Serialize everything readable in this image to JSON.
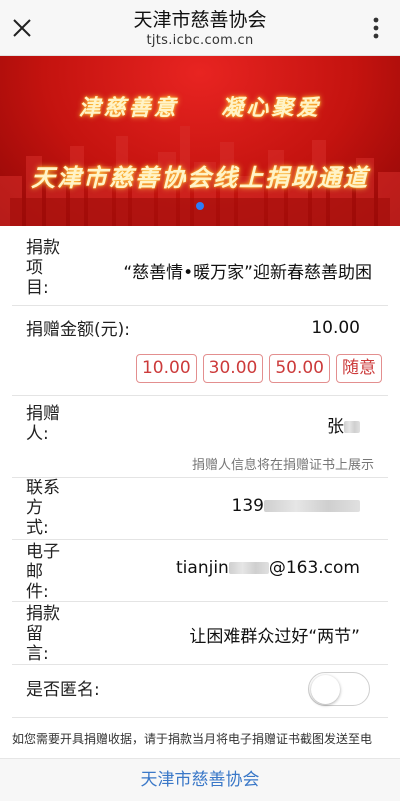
{
  "header": {
    "title": "天津市慈善协会",
    "url": "tjts.icbc.com.cn"
  },
  "banner": {
    "slogan_line1": "津慈善意    凝心聚爱",
    "slogan_line2": "天津市慈善协会线上捐助通道",
    "slide_count": 1,
    "active_slide": 0
  },
  "form": {
    "project": {
      "label_lines": [
        "捐款",
        "项",
        "目:"
      ],
      "value": "“慈善情•暖万家”迎新春慈善助困"
    },
    "amount": {
      "label": "捐赠金额(元):",
      "value": "10.00",
      "options": [
        "10.00",
        "30.00",
        "50.00",
        "随意"
      ]
    },
    "donor": {
      "label_lines": [
        "捐赠",
        "人:"
      ],
      "value_prefix": "张",
      "hint": "捐赠人信息将在捐赠证书上展示"
    },
    "contact": {
      "label_lines": [
        "联系",
        "方",
        "式:"
      ],
      "value_prefix": "139"
    },
    "email": {
      "label_lines": [
        "电子",
        "邮",
        "件:"
      ],
      "value_prefix": "tianjin",
      "value_suffix": "@163.com"
    },
    "message": {
      "label_lines": [
        "捐款",
        "留",
        "言:"
      ],
      "value": "让困难群众过好“两节”"
    },
    "anonymous": {
      "label": "是否匿名:",
      "enabled": false
    }
  },
  "notice": "如您需要开具捐赠收据，请于捐款当月将电子捐赠证书截图发送至电",
  "footer": {
    "label": "天津市慈善协会"
  },
  "colors": {
    "accent_red": "#cc3b3b",
    "link_blue": "#3a78c8",
    "banner_red": "#c4130f"
  }
}
